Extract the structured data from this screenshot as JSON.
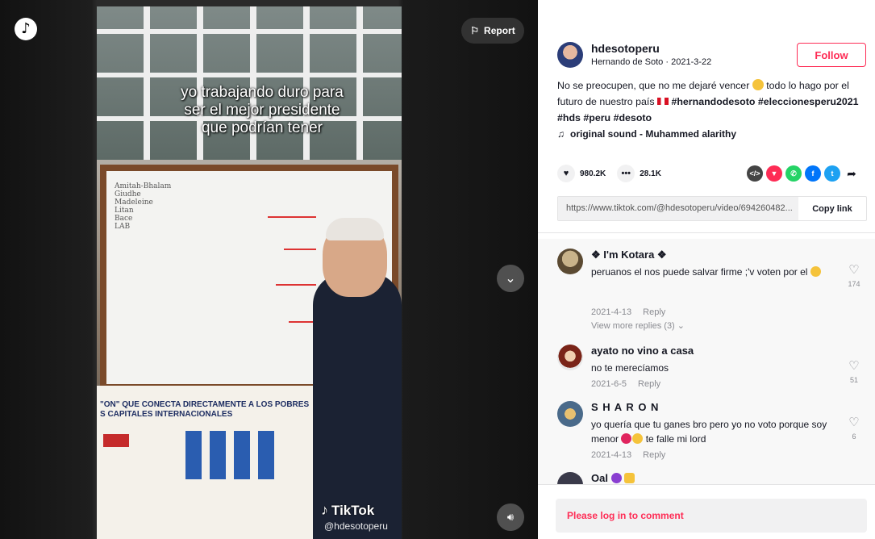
{
  "video": {
    "report_label": "Report",
    "caption_lines": [
      "yo trabajando duro para",
      "ser el mejor presidente",
      "que podrían tener"
    ],
    "watermark_brand": "TikTok",
    "watermark_handle": "@hdesotoperu",
    "poster_heading_1": "\"ON\" QUE CONECTA DIRECTAMENTE A LOS POBRES",
    "poster_heading_2": "S CAPITALES INTERNACIONALES"
  },
  "author": {
    "username": "hdesotoperu",
    "display_name": "Hernando de Soto",
    "date": "2021-3-22",
    "follow_label": "Follow"
  },
  "description": {
    "text_1": "No se preocupen, que no me dejaré vencer ",
    "text_2": " todo lo hago por el futuro de nuestro país ",
    "tags": [
      "#hernandodesoto",
      "#eleccionesperu2021",
      "#hds",
      "#peru",
      "#desoto"
    ]
  },
  "sound": {
    "title": "original sound - Muhammed alarithy"
  },
  "stats": {
    "likes": "980.2K",
    "comments": "28.1K"
  },
  "share": {
    "icons": [
      "embed-icon",
      "pinterest-like-icon",
      "whatsapp-icon",
      "facebook-icon",
      "twitter-icon",
      "share-arrow-icon"
    ],
    "colors": {
      "embed": "#444444",
      "red": "#fe2c55",
      "whatsapp": "#25d366",
      "facebook": "#0075fa",
      "twitter": "#1da1f2"
    }
  },
  "link": {
    "url": "https://www.tiktok.com/@hdesotoperu/video/694260482...",
    "copy_label": "Copy link"
  },
  "comments": [
    {
      "name": "❖ I'm Kotara ❖",
      "text": "peruanos el nos puede salvar firme ;'v voten por el",
      "date": "2021-4-13",
      "reply": "Reply",
      "likes": "174",
      "view_more": "View more replies (3)"
    },
    {
      "name": "ayato no vino a casa",
      "text": "no te merecíamos",
      "date": "2021-6-5",
      "reply": "Reply",
      "likes": "51"
    },
    {
      "name": "S H A R O N",
      "text_1": "yo quería que tu ganes bro pero yo no voto porque soy menor ",
      "text_2": " te falle mi lord",
      "date": "2021-4-13",
      "reply": "Reply",
      "likes": "6"
    },
    {
      "name": "Oal"
    }
  ],
  "login_prompt": "Please log in to comment",
  "colors": {
    "accent": "#fe2c55",
    "text": "#161823",
    "muted": "#8a8b91"
  }
}
